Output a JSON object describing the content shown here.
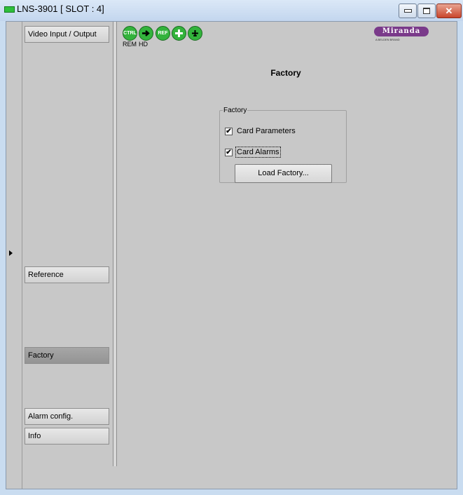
{
  "window": {
    "title": "LNS-3901 [ SLOT : 4]",
    "minimize_icon": "minimize-icon",
    "maximize_icon": "maximize-icon",
    "close_icon": "close-icon"
  },
  "nav": {
    "items": [
      {
        "label": "Video Input / Output",
        "active": false
      },
      {
        "label": "Reference",
        "active": false
      },
      {
        "label": "Factory",
        "active": true
      },
      {
        "label": "Alarm config.",
        "active": false
      },
      {
        "label": "Info",
        "active": false
      }
    ]
  },
  "status_bar": {
    "icons": [
      {
        "name": "ctrl-status-icon",
        "text": "CTRL",
        "color": "#33b33c"
      },
      {
        "name": "input-arrow-status-icon",
        "text": "",
        "color": "#33b33c"
      },
      {
        "name": "ref-status-icon",
        "text": "REF",
        "color": "#33b33c"
      },
      {
        "name": "plus-status-icon",
        "text": "",
        "color": "#33b33c"
      },
      {
        "name": "gpi-status-icon",
        "text": "",
        "color": "#33b33c"
      }
    ],
    "labels": [
      "REM",
      "HD"
    ]
  },
  "logo": {
    "brand": "Miranda",
    "tagline": "A BELDEN BRAND",
    "color": "#7a3a8a"
  },
  "page": {
    "title": "Factory",
    "group_label": "Factory",
    "checkboxes": [
      {
        "label": "Card Parameters",
        "checked": true
      },
      {
        "label": "Card Alarms",
        "checked": true
      }
    ],
    "load_button": "Load Factory..."
  }
}
